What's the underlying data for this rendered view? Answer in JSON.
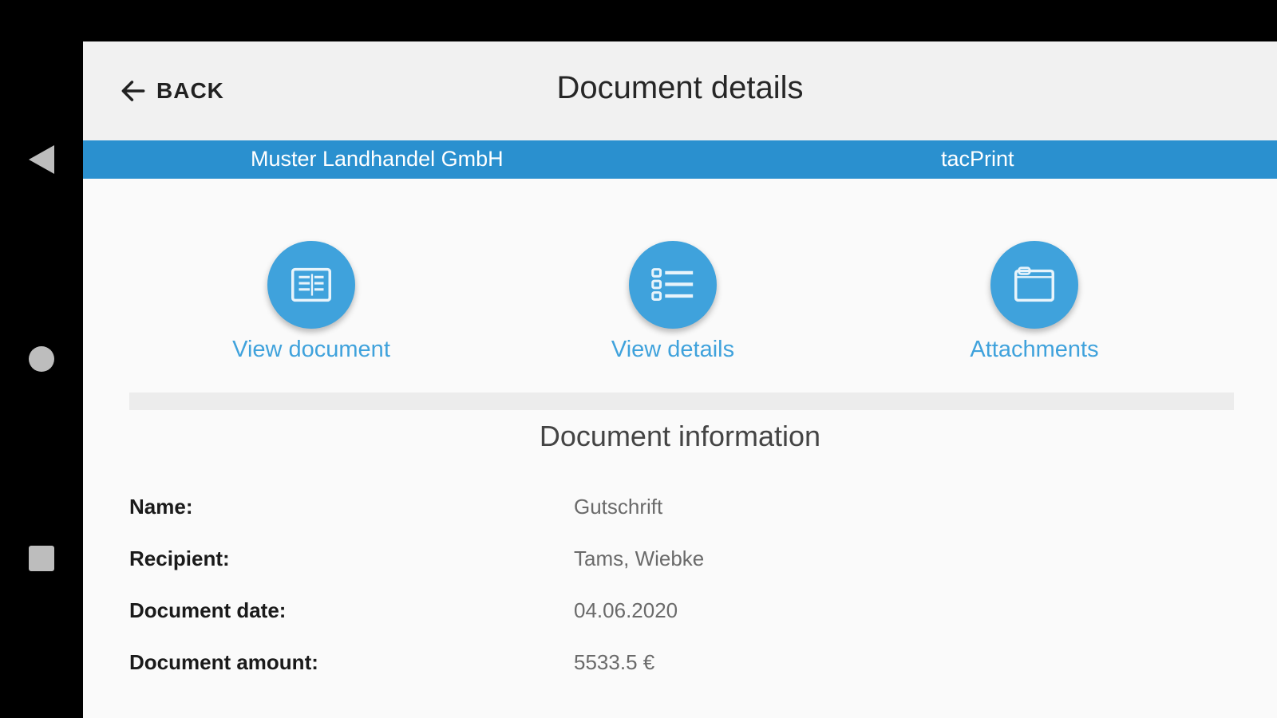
{
  "navbar": {
    "back_icon": "triangle-back-icon",
    "home_icon": "circle-home-icon",
    "recents_icon": "square-recents-icon"
  },
  "appbar": {
    "back_label": "BACK",
    "back_icon": "arrow-left-icon",
    "title": "Document details"
  },
  "banner": {
    "company": "Muster Landhandel GmbH",
    "app_name": "tacPrint",
    "color": "#2a90cf"
  },
  "actions": [
    {
      "label": "View document",
      "icon": "document-icon"
    },
    {
      "label": "View details",
      "icon": "list-details-icon"
    },
    {
      "label": "Attachments",
      "icon": "attachment-folder-icon"
    }
  ],
  "accent_color": "#3fa2dc",
  "info": {
    "title": "Document information",
    "rows": [
      {
        "key": "Name:",
        "value": "Gutschrift"
      },
      {
        "key": "Recipient:",
        "value": "Tams, Wiebke"
      },
      {
        "key": "Document date:",
        "value": "04.06.2020"
      },
      {
        "key": "Document amount:",
        "value": "5533.5 €"
      }
    ]
  }
}
